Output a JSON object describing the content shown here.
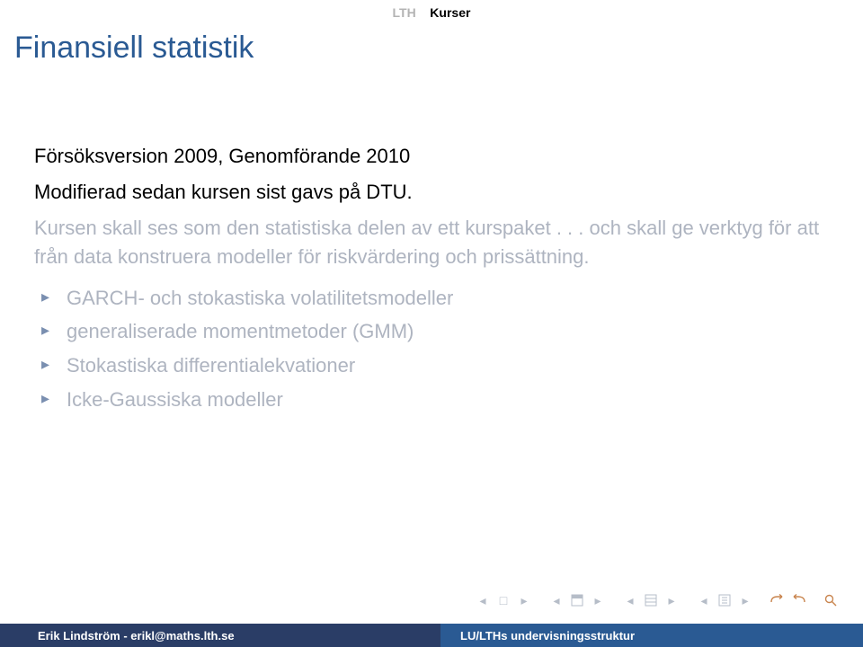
{
  "header": {
    "crumb_left": "LTH",
    "crumb_right": "Kurser"
  },
  "title": "Finansiell statistik",
  "content": {
    "para1": "Försöksversion 2009, Genomförande 2010",
    "para2": "Modifierad sedan kursen sist gavs på DTU.",
    "dim1": "Kursen skall ses som den statistiska delen av ett kurspaket . . . och skall ge verktyg för att från data konstruera modeller för riskvärdering och prissättning.",
    "bullets": [
      "GARCH- och stokastiska volatilitetsmodeller",
      "generaliserade momentmetoder (GMM)",
      "Stokastiska differentialekvationer",
      "Icke-Gaussiska modeller"
    ]
  },
  "footer": {
    "left": "Erik Lindström - erikl@maths.lth.se",
    "right": "LU/LTHs undervisningsstruktur"
  }
}
